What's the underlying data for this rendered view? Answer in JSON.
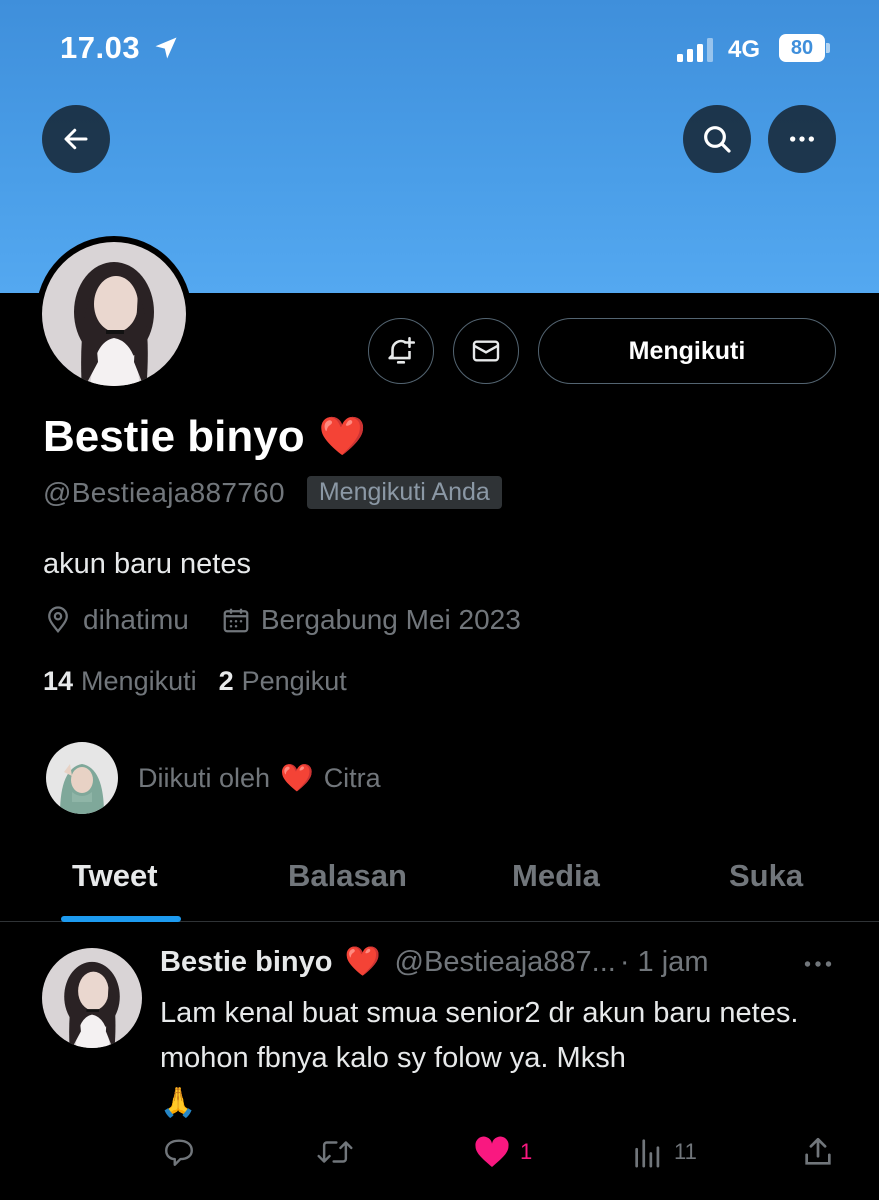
{
  "status_bar": {
    "time": "17.03",
    "network": "4G",
    "battery": "80"
  },
  "header": {
    "back_icon": "arrow-left-icon",
    "search_icon": "search-icon",
    "more_icon": "more-horizontal-icon",
    "banner_color": "#4a9ee8"
  },
  "profile": {
    "display_name": "Bestie binyo",
    "name_emoji": "❤️",
    "handle": "@Bestieaja887760",
    "follows_you_badge": "Mengikuti Anda",
    "follow_button": "Mengikuti",
    "bio": "akun baru netes",
    "location": "dihatimu",
    "joined": "Bergabung Mei 2023",
    "following_count": "14",
    "following_label": "Mengikuti",
    "followers_count": "2",
    "followers_label": "Pengikut",
    "followed_by_prefix": "Diikuti oleh",
    "followed_by_emoji": "❤️",
    "followed_by_name": "Citra"
  },
  "tabs": [
    {
      "label": "Tweet",
      "active": true
    },
    {
      "label": "Balasan",
      "active": false
    },
    {
      "label": "Media",
      "active": false
    },
    {
      "label": "Suka",
      "active": false
    }
  ],
  "tweet": {
    "author_name": "Bestie binyo",
    "author_emoji": "❤️",
    "author_handle": "@Bestieaja887...",
    "time": "· 1 jam",
    "text": "Lam kenal buat smua senior2 dr akun baru netes. mohon fbnya kalo sy folow ya. Mksh",
    "text_emoji": "🙏",
    "replies": "",
    "retweets": "",
    "likes": "1",
    "views": "11",
    "like_color": "#f91880",
    "accent_color": "#1d9bf0"
  }
}
